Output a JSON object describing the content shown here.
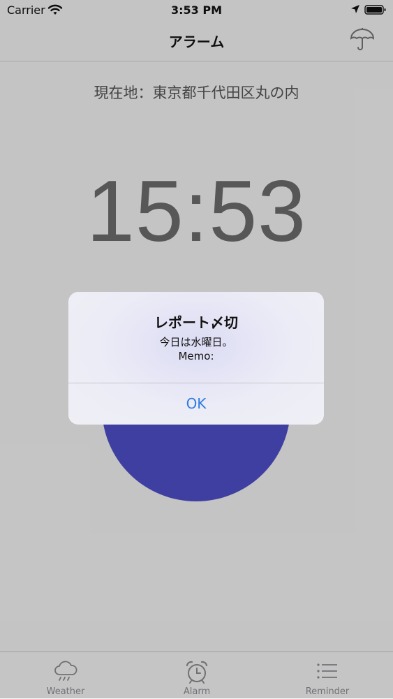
{
  "status_bar": {
    "carrier": "Carrier",
    "time": "3:53 PM"
  },
  "nav": {
    "title": "アラーム",
    "right_icon": "umbrella-icon"
  },
  "main": {
    "location": "現在地：東京都千代田区丸の内",
    "clock": "15:53",
    "circle_color": "#4e4fc9"
  },
  "alert": {
    "title": "レポート〆切",
    "message_line1": "今日は水曜日。",
    "message_line2": "Memo:",
    "ok_label": "OK"
  },
  "tab_bar": {
    "tabs": [
      {
        "label": "Weather",
        "icon": "cloud-rain-icon"
      },
      {
        "label": "Alarm",
        "icon": "alarm-clock-icon"
      },
      {
        "label": "Reminder",
        "icon": "list-icon"
      }
    ]
  },
  "colors": {
    "accent": "#2f7de1",
    "tab_inactive": "#8e8e93"
  }
}
